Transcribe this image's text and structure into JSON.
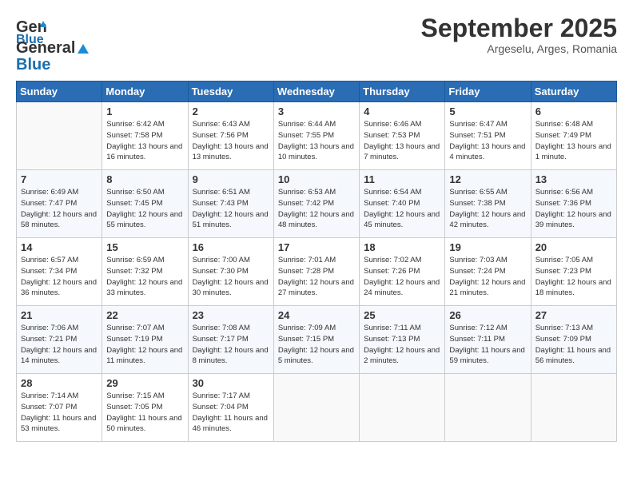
{
  "logo": {
    "line1": "General",
    "line2": "Blue"
  },
  "header": {
    "title": "September 2025",
    "subtitle": "Argeselu, Arges, Romania"
  },
  "weekdays": [
    "Sunday",
    "Monday",
    "Tuesday",
    "Wednesday",
    "Thursday",
    "Friday",
    "Saturday"
  ],
  "weeks": [
    [
      {
        "day": "",
        "empty": true
      },
      {
        "day": "1",
        "sunrise": "Sunrise: 6:42 AM",
        "sunset": "Sunset: 7:58 PM",
        "daylight": "Daylight: 13 hours and 16 minutes."
      },
      {
        "day": "2",
        "sunrise": "Sunrise: 6:43 AM",
        "sunset": "Sunset: 7:56 PM",
        "daylight": "Daylight: 13 hours and 13 minutes."
      },
      {
        "day": "3",
        "sunrise": "Sunrise: 6:44 AM",
        "sunset": "Sunset: 7:55 PM",
        "daylight": "Daylight: 13 hours and 10 minutes."
      },
      {
        "day": "4",
        "sunrise": "Sunrise: 6:46 AM",
        "sunset": "Sunset: 7:53 PM",
        "daylight": "Daylight: 13 hours and 7 minutes."
      },
      {
        "day": "5",
        "sunrise": "Sunrise: 6:47 AM",
        "sunset": "Sunset: 7:51 PM",
        "daylight": "Daylight: 13 hours and 4 minutes."
      },
      {
        "day": "6",
        "sunrise": "Sunrise: 6:48 AM",
        "sunset": "Sunset: 7:49 PM",
        "daylight": "Daylight: 13 hours and 1 minute."
      }
    ],
    [
      {
        "day": "7",
        "sunrise": "Sunrise: 6:49 AM",
        "sunset": "Sunset: 7:47 PM",
        "daylight": "Daylight: 12 hours and 58 minutes."
      },
      {
        "day": "8",
        "sunrise": "Sunrise: 6:50 AM",
        "sunset": "Sunset: 7:45 PM",
        "daylight": "Daylight: 12 hours and 55 minutes."
      },
      {
        "day": "9",
        "sunrise": "Sunrise: 6:51 AM",
        "sunset": "Sunset: 7:43 PM",
        "daylight": "Daylight: 12 hours and 51 minutes."
      },
      {
        "day": "10",
        "sunrise": "Sunrise: 6:53 AM",
        "sunset": "Sunset: 7:42 PM",
        "daylight": "Daylight: 12 hours and 48 minutes."
      },
      {
        "day": "11",
        "sunrise": "Sunrise: 6:54 AM",
        "sunset": "Sunset: 7:40 PM",
        "daylight": "Daylight: 12 hours and 45 minutes."
      },
      {
        "day": "12",
        "sunrise": "Sunrise: 6:55 AM",
        "sunset": "Sunset: 7:38 PM",
        "daylight": "Daylight: 12 hours and 42 minutes."
      },
      {
        "day": "13",
        "sunrise": "Sunrise: 6:56 AM",
        "sunset": "Sunset: 7:36 PM",
        "daylight": "Daylight: 12 hours and 39 minutes."
      }
    ],
    [
      {
        "day": "14",
        "sunrise": "Sunrise: 6:57 AM",
        "sunset": "Sunset: 7:34 PM",
        "daylight": "Daylight: 12 hours and 36 minutes."
      },
      {
        "day": "15",
        "sunrise": "Sunrise: 6:59 AM",
        "sunset": "Sunset: 7:32 PM",
        "daylight": "Daylight: 12 hours and 33 minutes."
      },
      {
        "day": "16",
        "sunrise": "Sunrise: 7:00 AM",
        "sunset": "Sunset: 7:30 PM",
        "daylight": "Daylight: 12 hours and 30 minutes."
      },
      {
        "day": "17",
        "sunrise": "Sunrise: 7:01 AM",
        "sunset": "Sunset: 7:28 PM",
        "daylight": "Daylight: 12 hours and 27 minutes."
      },
      {
        "day": "18",
        "sunrise": "Sunrise: 7:02 AM",
        "sunset": "Sunset: 7:26 PM",
        "daylight": "Daylight: 12 hours and 24 minutes."
      },
      {
        "day": "19",
        "sunrise": "Sunrise: 7:03 AM",
        "sunset": "Sunset: 7:24 PM",
        "daylight": "Daylight: 12 hours and 21 minutes."
      },
      {
        "day": "20",
        "sunrise": "Sunrise: 7:05 AM",
        "sunset": "Sunset: 7:23 PM",
        "daylight": "Daylight: 12 hours and 18 minutes."
      }
    ],
    [
      {
        "day": "21",
        "sunrise": "Sunrise: 7:06 AM",
        "sunset": "Sunset: 7:21 PM",
        "daylight": "Daylight: 12 hours and 14 minutes."
      },
      {
        "day": "22",
        "sunrise": "Sunrise: 7:07 AM",
        "sunset": "Sunset: 7:19 PM",
        "daylight": "Daylight: 12 hours and 11 minutes."
      },
      {
        "day": "23",
        "sunrise": "Sunrise: 7:08 AM",
        "sunset": "Sunset: 7:17 PM",
        "daylight": "Daylight: 12 hours and 8 minutes."
      },
      {
        "day": "24",
        "sunrise": "Sunrise: 7:09 AM",
        "sunset": "Sunset: 7:15 PM",
        "daylight": "Daylight: 12 hours and 5 minutes."
      },
      {
        "day": "25",
        "sunrise": "Sunrise: 7:11 AM",
        "sunset": "Sunset: 7:13 PM",
        "daylight": "Daylight: 12 hours and 2 minutes."
      },
      {
        "day": "26",
        "sunrise": "Sunrise: 7:12 AM",
        "sunset": "Sunset: 7:11 PM",
        "daylight": "Daylight: 11 hours and 59 minutes."
      },
      {
        "day": "27",
        "sunrise": "Sunrise: 7:13 AM",
        "sunset": "Sunset: 7:09 PM",
        "daylight": "Daylight: 11 hours and 56 minutes."
      }
    ],
    [
      {
        "day": "28",
        "sunrise": "Sunrise: 7:14 AM",
        "sunset": "Sunset: 7:07 PM",
        "daylight": "Daylight: 11 hours and 53 minutes."
      },
      {
        "day": "29",
        "sunrise": "Sunrise: 7:15 AM",
        "sunset": "Sunset: 7:05 PM",
        "daylight": "Daylight: 11 hours and 50 minutes."
      },
      {
        "day": "30",
        "sunrise": "Sunrise: 7:17 AM",
        "sunset": "Sunset: 7:04 PM",
        "daylight": "Daylight: 11 hours and 46 minutes."
      },
      {
        "day": "",
        "empty": true
      },
      {
        "day": "",
        "empty": true
      },
      {
        "day": "",
        "empty": true
      },
      {
        "day": "",
        "empty": true
      }
    ]
  ]
}
